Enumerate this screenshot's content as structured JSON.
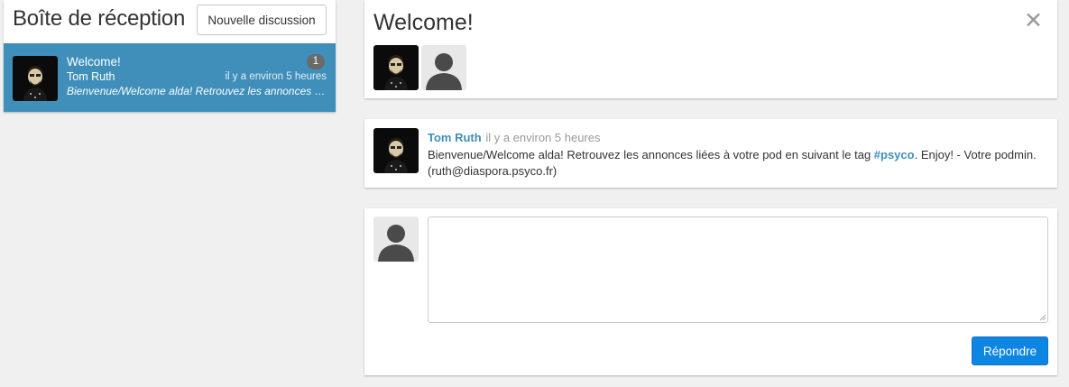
{
  "inbox": {
    "title": "Boîte de réception",
    "new_button_label": "Nouvelle discussion",
    "conversations": [
      {
        "subject": "Welcome!",
        "author": "Tom Ruth",
        "time": "il y a environ 5 heures",
        "unread_count": "1",
        "snippet": "Bienvenue/Welcome alda! Retrouvez les annonces liées à votre pod en suivant le tag #psyco. Enjoy! - Votre podmin. (ruth@diaspora.psyco.fr)",
        "avatar_icon": "user-photo-avatar"
      }
    ]
  },
  "conversation": {
    "title": "Welcome!",
    "close_icon": "close-icon",
    "participants": [
      {
        "icon": "user-photo-avatar"
      },
      {
        "icon": "default-user-avatar"
      }
    ]
  },
  "message": {
    "author": "Tom Ruth",
    "time": "il y a environ 5 heures",
    "body_before_tag": "Bienvenue/Welcome alda! Retrouvez les annonces liées à votre pod en suivant le tag ",
    "hashtag": "#psyco",
    "body_after_tag": ". Enjoy! - Votre podmin. (ruth@diaspora.psyco.fr)"
  },
  "reply": {
    "value": "",
    "button_label": "Répondre"
  },
  "colors": {
    "accent": "#3f8fba",
    "button_primary": "#0d85e3",
    "page_background": "#f0f0f0"
  }
}
